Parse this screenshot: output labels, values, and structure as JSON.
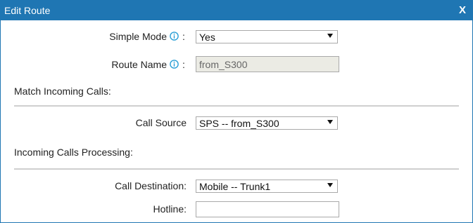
{
  "dialog": {
    "title": "Edit Route",
    "close_label": "X"
  },
  "form": {
    "simple_mode": {
      "label": "Simple Mode",
      "colon": ":",
      "value": "Yes"
    },
    "route_name": {
      "label": "Route Name",
      "colon": ":",
      "value": "from_S300"
    },
    "match_section": "Match Incoming Calls:",
    "call_source": {
      "label": "Call Source",
      "value": "SPS -- from_S300"
    },
    "processing_section": "Incoming Calls Processing:",
    "call_destination": {
      "label": "Call Destination:",
      "value": "Mobile -- Trunk1"
    },
    "hotline": {
      "label": "Hotline:",
      "value": ""
    }
  },
  "colors": {
    "accent": "#1f76b3",
    "info_icon": "#2a9fd6"
  },
  "icons": [
    "info-icon",
    "dropdown-arrow-icon",
    "close-icon"
  ]
}
